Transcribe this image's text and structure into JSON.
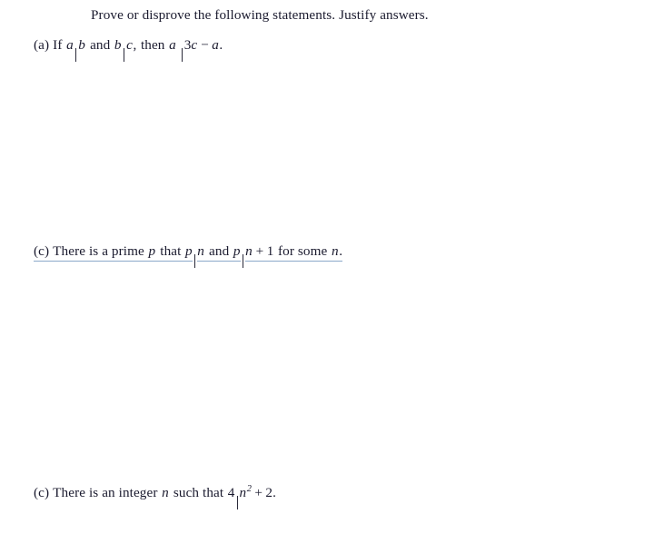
{
  "document": {
    "background_color": "#ffffff",
    "text_color": "#1a1a2e",
    "annotation_underline_color": "#8ba9c9",
    "header": {
      "text": "Prove or disprove the following statements.  Justify answers."
    },
    "statements": [
      {
        "label": "(a)",
        "plain_text": "If a|b and b|c, then a|3c − a.",
        "tokens": {
          "if": "If",
          "var_a1": "a",
          "var_b1": "b",
          "and": "and",
          "var_b2": "b",
          "var_c1": "c",
          "comma": ",",
          "then": "then",
          "var_a2": "a",
          "coef3": "3",
          "var_c2": "c",
          "minus": "−",
          "var_a3": "a",
          "period": "."
        },
        "underlined": false
      },
      {
        "label": "(c)",
        "plain_text": "There is a prime p that p|n and p|n + 1 for some n.",
        "tokens": {
          "there_is_a_prime": "There is a prime",
          "var_p1": "p",
          "that": "that",
          "var_p2": "p",
          "var_n1": "n",
          "and": "and",
          "var_p3": "p",
          "var_n2": "n",
          "plus": "+",
          "one": "1",
          "for_some": "for some",
          "var_n3": "n",
          "period": "."
        },
        "underlined": true
      },
      {
        "label": "(c)",
        "plain_text": "There is an integer n such that 4|n² + 2.",
        "tokens": {
          "there_is_an_integer": "There is an integer",
          "var_n1": "n",
          "such_that": "such that",
          "four": "4",
          "var_n2": "n",
          "exponent": "2",
          "plus": "+",
          "two": "2",
          "period": "."
        },
        "underlined": false
      }
    ]
  }
}
